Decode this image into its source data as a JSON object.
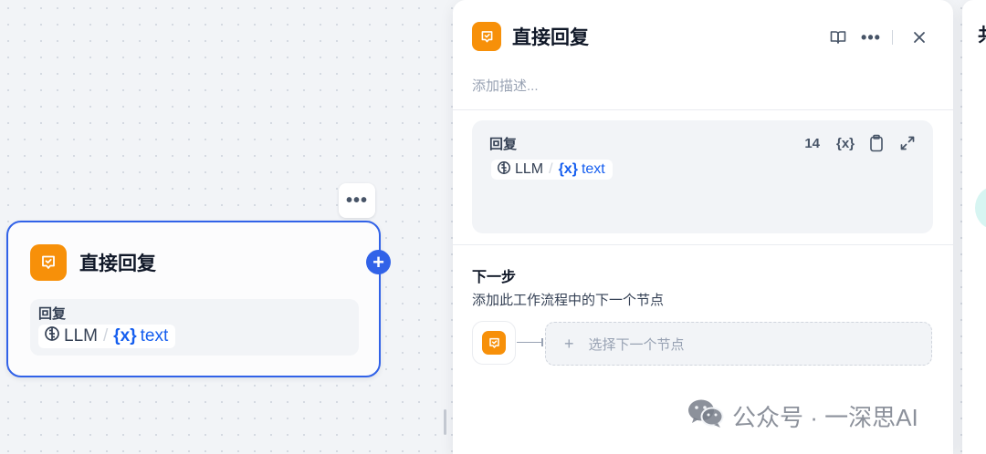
{
  "node": {
    "title": "直接回复",
    "body_label": "回复",
    "source_node": "LLM",
    "separator": "/",
    "var_symbol": "{x}",
    "var_name": "text",
    "more_label": "•••",
    "add_label": "+"
  },
  "panel": {
    "title": "直接回复",
    "description_placeholder": "添加描述...",
    "more_label": "•••",
    "reply": {
      "label": "回复",
      "char_count": "14",
      "var_symbol": "{x}",
      "source_node": "LLM",
      "separator": "/",
      "var_name": "text"
    },
    "next_step": {
      "title": "下一步",
      "description": "添加此工作流程中的下一个节点",
      "select_label": "选择下一个节点",
      "plus": "+"
    }
  },
  "right_panel": {
    "glyph": "共"
  },
  "watermark": {
    "text": "公众号 · 一深思AI"
  },
  "icons": {
    "node_icon": "reply-badge-icon",
    "llm_icon": "llm-icon",
    "book_icon": "book-icon",
    "close_icon": "close-icon",
    "clipboard_icon": "clipboard-icon",
    "expand_icon": "expand-icon",
    "wechat_icon": "wechat-icon"
  },
  "colors": {
    "accent_orange": "#F79009",
    "selection_blue": "#3162E8",
    "variable_blue": "#155EEF"
  }
}
